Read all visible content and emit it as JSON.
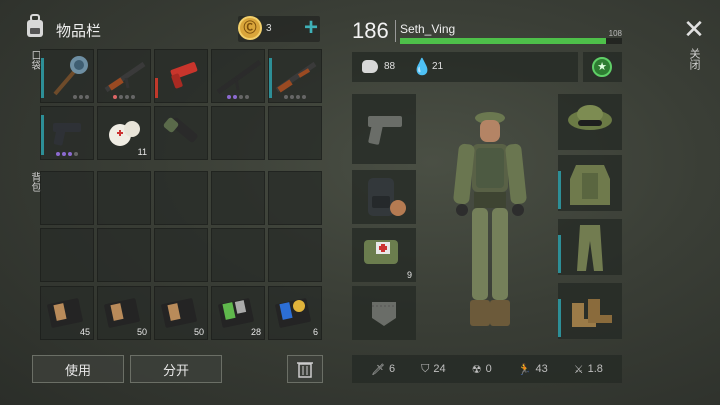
{
  "inventory": {
    "title": "物品栏",
    "coins": "3",
    "pockets_label": "口袋",
    "backpack_label": "背包",
    "pocket_items": [
      {
        "name": "mace",
        "count": ""
      },
      {
        "name": "assault-rifle",
        "count": ""
      },
      {
        "name": "flare-gun",
        "count": ""
      },
      {
        "name": "rifle-black",
        "count": ""
      },
      {
        "name": "ak-rifle",
        "count": ""
      },
      {
        "name": "pistol",
        "count": ""
      },
      {
        "name": "bandage",
        "count": "11"
      },
      {
        "name": "flashlight",
        "count": ""
      }
    ],
    "bottom_items": [
      {
        "name": "notebook",
        "count": "45"
      },
      {
        "name": "notebook",
        "count": "50"
      },
      {
        "name": "notebook",
        "count": "50"
      },
      {
        "name": "green-badge-book",
        "count": "28"
      },
      {
        "name": "gold-badge-book",
        "count": "6"
      }
    ]
  },
  "actions": {
    "use_label": "使用",
    "split_label": "分开"
  },
  "player": {
    "level": "186",
    "name": "Seth_Ving",
    "xp_value": "108",
    "xp_progress": 0.93,
    "food": "88",
    "water": "21"
  },
  "equip_slots": {
    "backpack_count": "",
    "medkit_count": "9"
  },
  "stats": [
    {
      "icon": "sword-icon",
      "value": "6"
    },
    {
      "icon": "shield-icon",
      "value": "24"
    },
    {
      "icon": "radiation-icon",
      "value": "0"
    },
    {
      "icon": "run-icon",
      "value": "43"
    },
    {
      "icon": "speed-icon",
      "value": "1.8"
    }
  ],
  "close_label": "关闭",
  "colors": {
    "accent": "#2fa3a8",
    "xp_bar": "#4ec04a",
    "plus": "#3fb1b8"
  }
}
